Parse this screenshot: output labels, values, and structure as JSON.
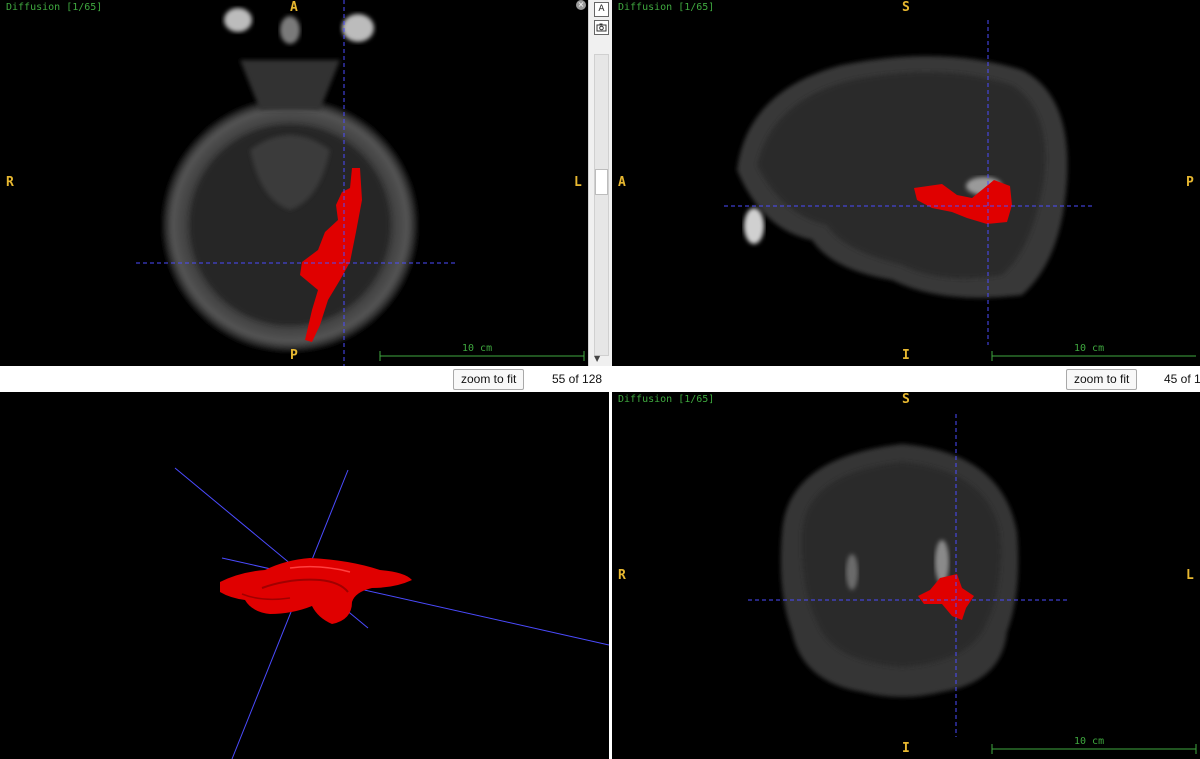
{
  "views": {
    "axial": {
      "title": "Diffusion [1/65]",
      "top": "A",
      "bottom": "P",
      "left": "R",
      "right": "L",
      "scale": "10 cm",
      "zoom_label": "zoom to fit",
      "slice": "55 of 128"
    },
    "sagittal": {
      "title": "Diffusion [1/65]",
      "top": "S",
      "bottom": "I",
      "left": "A",
      "right": "P",
      "scale": "10 cm",
      "zoom_label": "zoom to fit",
      "slice": "45 of 1"
    },
    "render3d": {},
    "coronal": {
      "title": "Diffusion [1/65]",
      "top": "S",
      "bottom": "I",
      "left": "R",
      "right": "L",
      "scale": "10 cm"
    }
  },
  "tools": {
    "annotate_label": "A",
    "close_label": "×",
    "scroll_down_label": "▼"
  },
  "colors": {
    "crosshair": "#4b4bff",
    "overlay": "#e00000",
    "label": "#e8b830",
    "title": "#3fa83f"
  }
}
